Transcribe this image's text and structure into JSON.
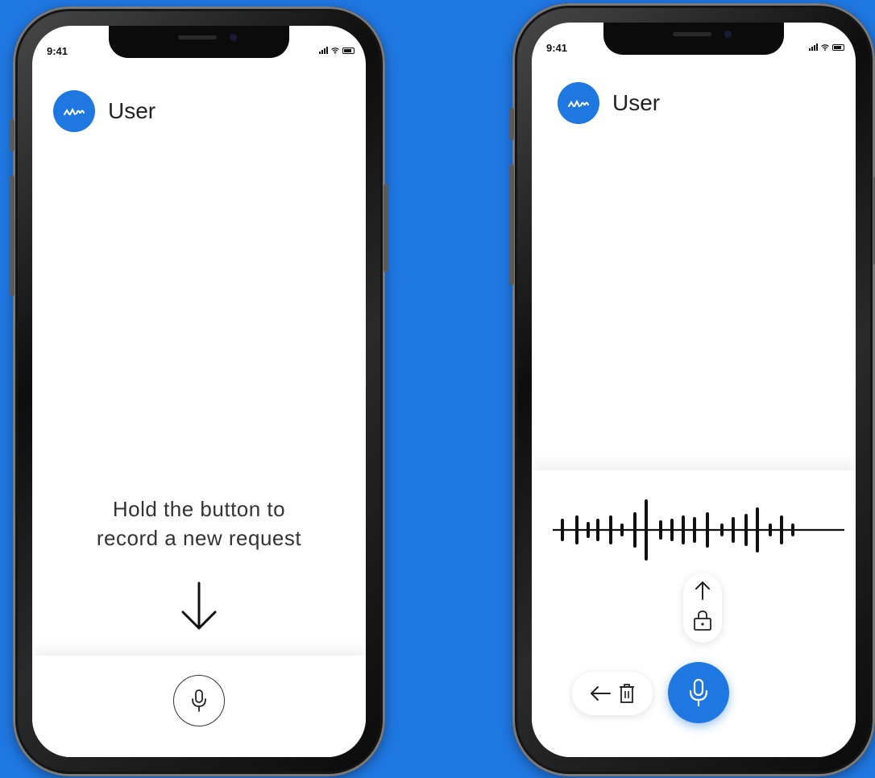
{
  "theme": {
    "accent": "#1f77e1",
    "background": "#1f77e1",
    "screen": "#ffffff",
    "text": "#222222"
  },
  "left_phone": {
    "status_bar": {
      "time": "9:41"
    },
    "header": {
      "avatar_icon": "logo-icon",
      "user_name": "User"
    },
    "hint": {
      "line1": "Hold the button to",
      "line2": "record a new request"
    },
    "arrow_icon": "arrow-down-icon",
    "mic_button": {
      "icon": "microphone-icon",
      "state": "idle"
    }
  },
  "right_phone": {
    "status_bar": {
      "time": "9:41"
    },
    "header": {
      "avatar_icon": "logo-icon",
      "user_name": "User"
    },
    "waveform_icon": "waveform-icon",
    "lock_control": {
      "arrow_icon": "arrow-up-icon",
      "lock_icon": "lock-icon"
    },
    "cancel_control": {
      "arrow_icon": "arrow-left-icon",
      "delete_icon": "trash-icon"
    },
    "mic_button": {
      "icon": "microphone-icon",
      "state": "recording"
    }
  }
}
